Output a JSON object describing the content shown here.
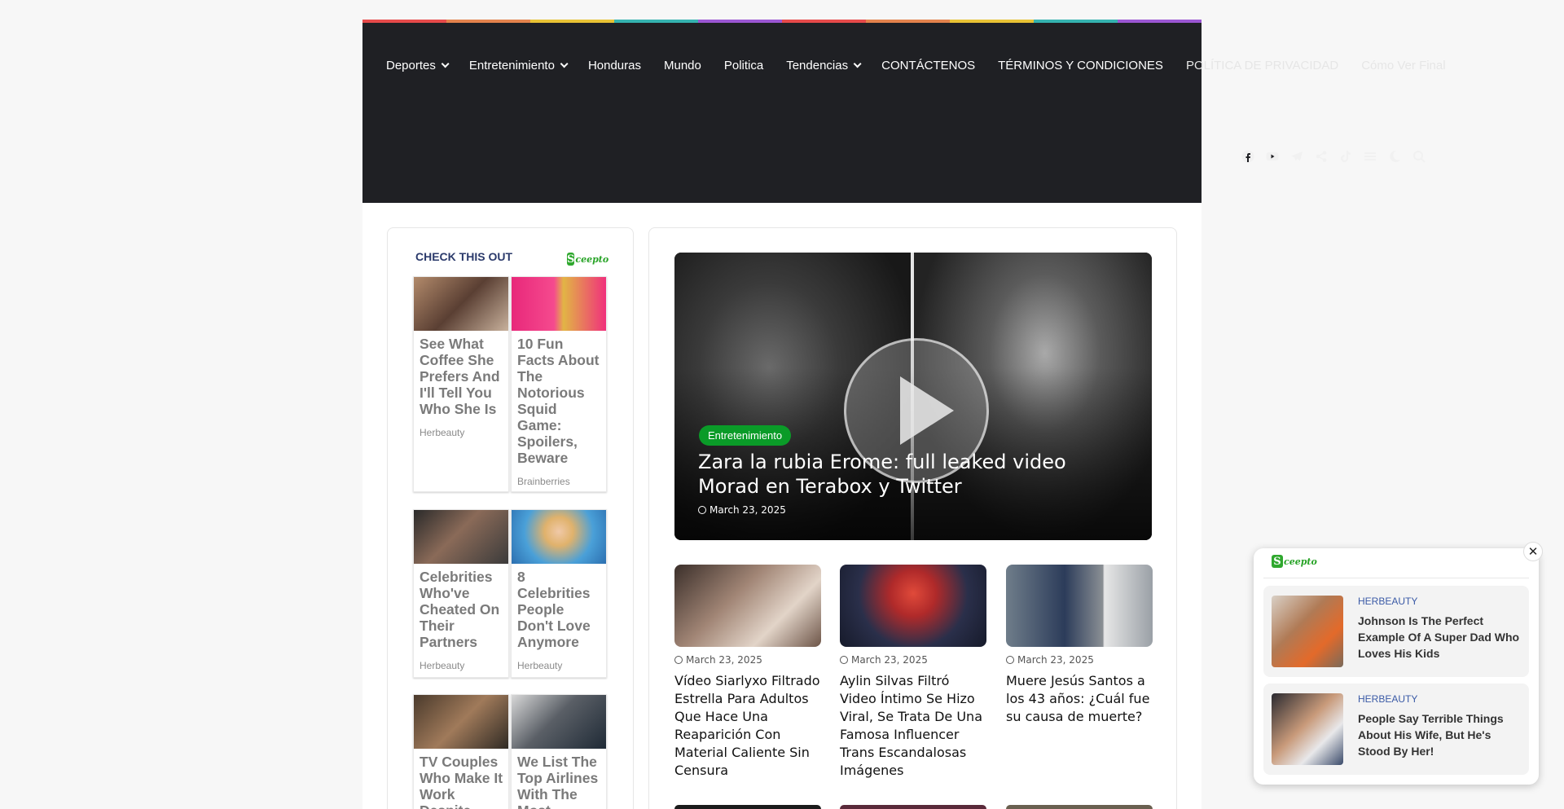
{
  "colors": {
    "rainbow": [
      "#e64a4a",
      "#e3834d",
      "#e8c235",
      "#35b3b0",
      "#9b57d3",
      "#e64a4a",
      "#e3834d",
      "#e8c235",
      "#35b3b0",
      "#9b57d3"
    ],
    "header_bg": "#1f2024",
    "badge": "#0a9b28",
    "widget_title": "#2b3a6b",
    "float_source": "#3a5aa6"
  },
  "nav": {
    "items": [
      {
        "label": "Deportes",
        "dropdown": true
      },
      {
        "label": "Entretenimiento",
        "dropdown": true
      },
      {
        "label": "Honduras",
        "dropdown": false
      },
      {
        "label": "Mundo",
        "dropdown": false
      },
      {
        "label": "Politica",
        "dropdown": false
      },
      {
        "label": "Tendencias",
        "dropdown": true
      },
      {
        "label": "CONTÁCTENOS",
        "dropdown": false
      },
      {
        "label": "TÉRMINOS Y CONDICIONES",
        "dropdown": false
      },
      {
        "label": "POLÍTICA DE PRIVACIDAD",
        "dropdown": false
      },
      {
        "label": "Cómo Ver Final",
        "dropdown": false
      }
    ]
  },
  "header_icons": [
    "facebook-icon",
    "youtube-icon",
    "telegram-icon",
    "share-icon",
    "tiktok-icon",
    "menu-icon",
    "moon-icon",
    "search-icon"
  ],
  "sidebar": {
    "widget_title": "CHECK THIS OUT",
    "logo_letter": "S",
    "logo_text": "ceepto",
    "cards": [
      {
        "title": "See What Coffee She Prefers And I'll Tell You Who She Is",
        "source": "Herbeauty"
      },
      {
        "title": "10 Fun Facts About The Notorious Squid Game: Spoilers, Beware",
        "source": "Brainberries"
      },
      {
        "title": "Celebrities Who've Cheated On Their Partners",
        "source": "Herbeauty"
      },
      {
        "title": "8 Celebrities People Don't Love Anymore",
        "source": "Herbeauty"
      },
      {
        "title": "TV Couples Who Make It Work Despite",
        "source": ""
      },
      {
        "title": "We List The Top Airlines With The Most",
        "source": ""
      }
    ]
  },
  "hero": {
    "category": "Entretenimiento",
    "title": "Zara la rubia Erome: full leaked video Morad en Terabox y Twitter",
    "date": "March 23, 2025"
  },
  "posts": [
    {
      "date": "March 23, 2025",
      "title": "Vídeo Siarlyxo Filtrado Estrella Para Adultos Que Hace Una Reaparición Con Material Caliente Sin Censura"
    },
    {
      "date": "March 23, 2025",
      "title": "Aylin Silvas Filtró Video Íntimo Se Hizo Viral, Se Trata De Una Famosa Influencer Trans Escandalosas Imágenes"
    },
    {
      "date": "March 23, 2025",
      "title": "Muere Jesús Santos a los 43 años: ¿Cuál fue su causa de muerte?"
    }
  ],
  "float_widget": {
    "logo_letter": "S",
    "logo_text": "ceepto",
    "close_label": "✕",
    "items": [
      {
        "source": "HERBEAUTY",
        "title": "Johnson Is The Perfect Example Of A Super Dad Who Loves His Kids"
      },
      {
        "source": "HERBEAUTY",
        "title": "People Say Terrible Things About His Wife, But He's Stood By Her!"
      }
    ]
  }
}
